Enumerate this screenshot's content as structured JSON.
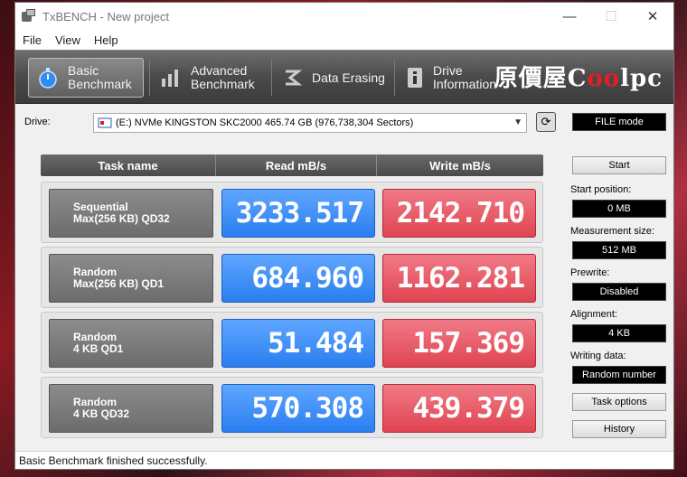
{
  "window": {
    "title": "TxBENCH - New project",
    "controls": {
      "minimize": "—",
      "maximize": "☐",
      "close": "✕"
    }
  },
  "menu": {
    "items": [
      "File",
      "View",
      "Help"
    ]
  },
  "toolbar": {
    "tabs": [
      {
        "line1": "Basic",
        "line2": "Benchmark",
        "icon": "stopwatch-icon"
      },
      {
        "line1": "Advanced",
        "line2": "Benchmark",
        "icon": "bar-chart-icon"
      },
      {
        "line1": "Data Erasing",
        "line2": "",
        "icon": "eraser-icon"
      },
      {
        "line1": "Drive",
        "line2": "Information",
        "icon": "drive-info-icon"
      }
    ],
    "logo": {
      "prefix": "原價屋C",
      "mid": "oo",
      "suffix": "lpc"
    }
  },
  "drive": {
    "label": "Drive:",
    "selected": "(E:) NVMe KINGSTON SKC2000  465.74 GB (976,738,304 Sectors)"
  },
  "table": {
    "headers": [
      "Task name",
      "Read mB/s",
      "Write mB/s"
    ],
    "rows": [
      {
        "task_line1": "Sequential",
        "task_line2": "Max(256 KB) QD32",
        "read": "3233.517",
        "write": "2142.710"
      },
      {
        "task_line1": "Random",
        "task_line2": "Max(256 KB) QD1",
        "read": "684.960",
        "write": "1162.281"
      },
      {
        "task_line1": "Random",
        "task_line2": "4 KB QD1",
        "read": "51.484",
        "write": "157.369"
      },
      {
        "task_line1": "Random",
        "task_line2": "4 KB QD32",
        "read": "570.308",
        "write": "439.379"
      }
    ]
  },
  "right_panel": {
    "mode": "FILE mode",
    "start_button": "Start",
    "start_position_label": "Start position:",
    "start_position_value": "0 MB",
    "measurement_size_label": "Measurement size:",
    "measurement_size_value": "512 MB",
    "prewrite_label": "Prewrite:",
    "prewrite_value": "Disabled",
    "alignment_label": "Alignment:",
    "alignment_value": "4 KB",
    "writing_data_label": "Writing data:",
    "writing_data_value": "Random number",
    "task_options_button": "Task options",
    "history_button": "History"
  },
  "status": {
    "text": "Basic Benchmark finished successfully."
  }
}
